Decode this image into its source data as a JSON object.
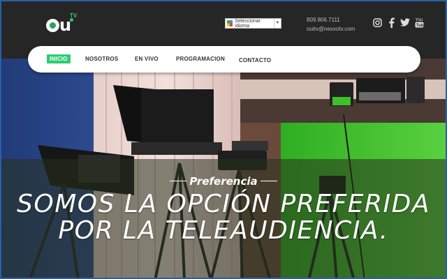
{
  "brand": {
    "logo_text": "Ou",
    "logo_tv": "TV"
  },
  "header": {
    "language_select": "Seleccionar idioma",
    "phone": "809.806.7111",
    "email": "ouitv@nexxotv.com"
  },
  "social": [
    {
      "icon": "instagram-icon"
    },
    {
      "icon": "facebook-icon"
    },
    {
      "icon": "twitter-icon"
    },
    {
      "icon": "youtube-icon",
      "label": "You"
    }
  ],
  "nav": {
    "items": [
      {
        "label": "INICIO",
        "active": true
      },
      {
        "label": "NOSOTROS",
        "active": false
      },
      {
        "label": "EN VIVO",
        "active": false
      },
      {
        "label": "PROGRAMACION",
        "active": false
      },
      {
        "label": "CONTACTO",
        "active": false
      }
    ]
  },
  "hero": {
    "kicker": "Preferencia",
    "headline_line1": "SOMOS LA OPCIÓN PREFERIDA",
    "headline_line2": "POR LA TELEAUDIENCIA."
  },
  "colors": {
    "accent": "#2ecc71",
    "topbar": "#262626",
    "greenscreen": "#3fbf2a"
  }
}
